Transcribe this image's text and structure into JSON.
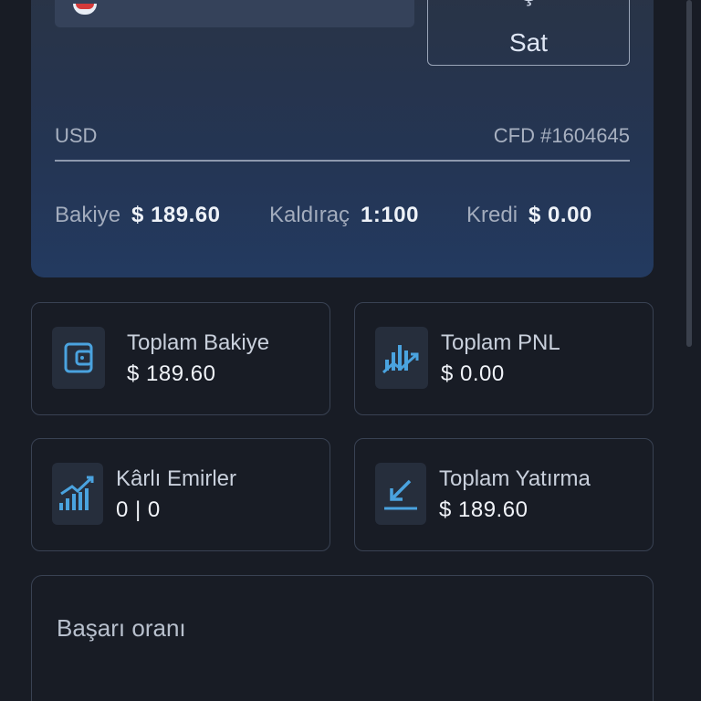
{
  "account": {
    "sell_label": "Sat",
    "sell_top_partial": "Ş",
    "currency": "USD",
    "account_id": "CFD #1604645",
    "stats": {
      "balance_label": "Bakiye",
      "balance_value": "$ 189.60",
      "leverage_label": "Kaldıraç",
      "leverage_value": "1:100",
      "credit_label": "Kredi",
      "credit_value": "$ 0.00"
    }
  },
  "tiles": {
    "total_balance": {
      "title": "Toplam Bakiye",
      "value": "$ 189.60",
      "icon": "wallet-icon"
    },
    "total_pnl": {
      "title": "Toplam PNL",
      "value": "$ 0.00",
      "icon": "chart-trend-icon"
    },
    "profitable_orders": {
      "title": "Kârlı Emirler",
      "value": "0 | 0",
      "icon": "bar-check-icon"
    },
    "total_deposit": {
      "title": "Toplam Yatırma",
      "value": "$ 189.60",
      "icon": "deposit-arrow-icon"
    }
  },
  "success_rate": {
    "title": "Başarı oranı"
  },
  "colors": {
    "background": "#181c25",
    "accent": "#4aa3df",
    "card_gradient_end": "#233a60"
  }
}
